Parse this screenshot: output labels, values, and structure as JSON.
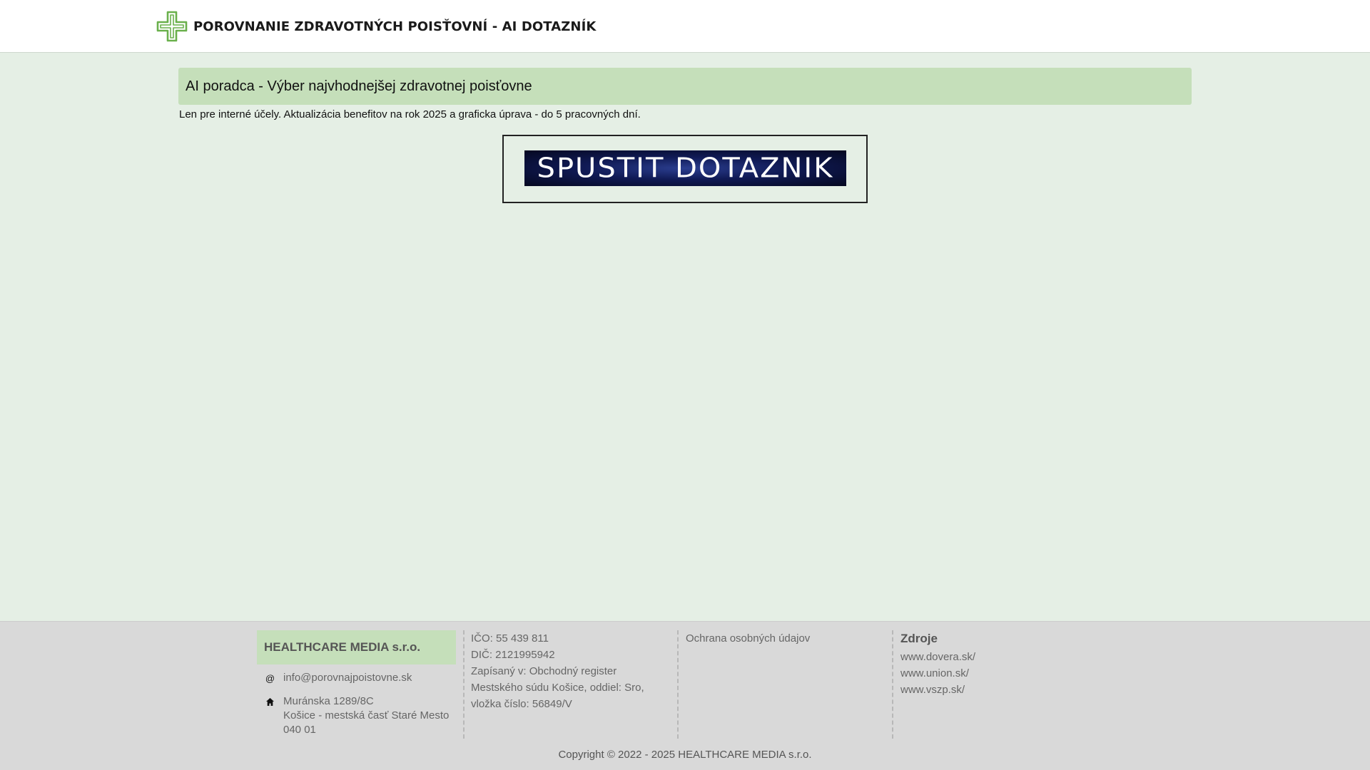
{
  "header": {
    "brand_title": "POROVNANIE ZDRAVOTNÝCH POISŤOVNÍ - AI DOTAZNÍK",
    "logo_icon": "medical-cross-icon",
    "accent_color": "#6ab04c"
  },
  "main": {
    "title": "AI poradca - Výber najvhodnejšej zdravotnej poisťovne",
    "subtitle": "Len pre interné účely. Aktualizácia benefitov na rok 2025 a graficka úprava - do 5 pracovných dní.",
    "cta_label": "SPUSTIT DOTAZNIK"
  },
  "footer": {
    "company": "HEALTHCARE MEDIA s.r.o.",
    "email_icon": "at-sign-icon",
    "email": "info@porovnajpoistovne.sk",
    "address_icon": "home-icon",
    "address_line1": "Muránska 1289/8C",
    "address_line2": "Košice - mestská časť Staré Mesto",
    "address_line3": "040 01",
    "ico": "IČO: 55 439 811",
    "dic": "DIČ: 2121995942",
    "register_line1": "Zapísaný v: Obchodný register",
    "register_line2": "Mestského súdu Košice, oddiel: Sro,",
    "register_line3": "vložka číslo: 56849/V",
    "privacy_link": "Ochrana osobných údajov",
    "sources_title": "Zdroje",
    "sources": [
      "www.dovera.sk/",
      "www.union.sk/",
      "www.vszp.sk/"
    ],
    "copyright": "Copyright © 2022 - 2025 HEALTHCARE MEDIA s.r.o."
  }
}
